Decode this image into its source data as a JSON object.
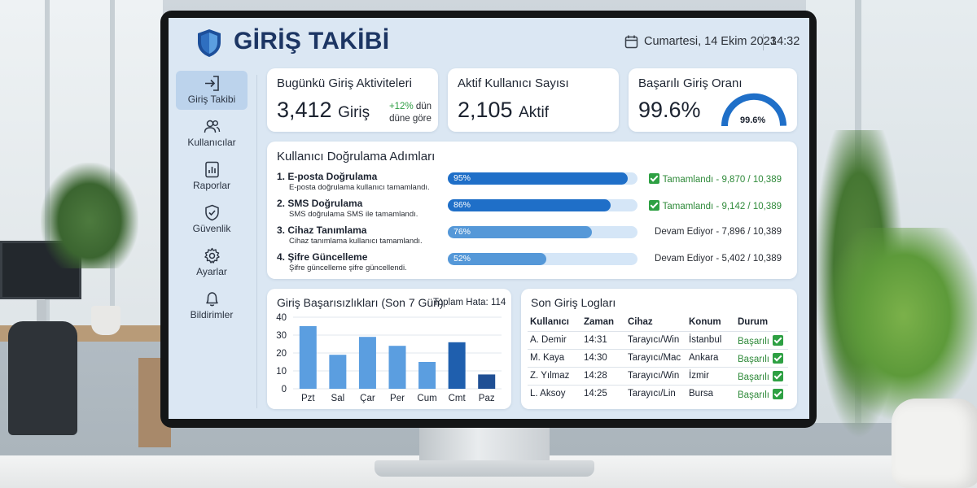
{
  "header": {
    "app_title": "GİRİŞ TAKİBİ",
    "date": "Cumartesi, 14 Ekim 2023",
    "time": "14:32"
  },
  "sidebar": {
    "items": [
      {
        "label": "Giriş Takibi",
        "icon": "login-icon",
        "active": true
      },
      {
        "label": "Kullanıcılar",
        "icon": "users-icon",
        "active": false
      },
      {
        "label": "Raporlar",
        "icon": "report-icon",
        "active": false
      },
      {
        "label": "Güvenlik",
        "icon": "shield-check-icon",
        "active": false
      },
      {
        "label": "Ayarlar",
        "icon": "gear-icon",
        "active": false
      },
      {
        "label": "Bildirimler",
        "icon": "bell-icon",
        "active": false
      }
    ]
  },
  "stats": {
    "daily": {
      "title": "Bugünkü Giriş Aktiviteleri",
      "value": "3,412",
      "unit": "Giriş",
      "trend_pct": "+12%",
      "trend_suffix": "dün",
      "trend_line2": "düne göre"
    },
    "active": {
      "title": "Aktif Kullanıcı Sayısı",
      "value": "2,105",
      "unit": "Aktif"
    },
    "success": {
      "title": "Başarılı Giriş Oranı",
      "value": "99.6%",
      "gauge_label": "99.6%",
      "gauge_fraction": 0.996
    }
  },
  "verification": {
    "title": "Kullanıcı Doğrulama Adımları",
    "steps": [
      {
        "num": "1.",
        "title": "E-posta Doğrulama",
        "desc": "E-posta doğrulama kullanıcı tamamlandı.",
        "pct_label": "95%",
        "fraction": 0.95,
        "status": "Tamamlandı",
        "count": "9,870 / 10,389",
        "done": true
      },
      {
        "num": "2.",
        "title": "SMS Doğrulama",
        "desc": "SMS doğrulama SMS ile tamamlandı.",
        "pct_label": "86%",
        "fraction": 0.86,
        "status": "Tamamlandı",
        "count": "9,142 / 10,389",
        "done": true
      },
      {
        "num": "3.",
        "title": "Cihaz Tanımlama",
        "desc": "Cihaz tanımlama kullanıcı tamamlandı.",
        "pct_label": "76%",
        "fraction": 0.76,
        "status": "Devam Ediyor",
        "count": "7,896 / 10,389",
        "done": false
      },
      {
        "num": "4.",
        "title": "Şifre Güncelleme",
        "desc": "Şifre güncelleme şifre güncellendi.",
        "pct_label": "52%",
        "fraction": 0.52,
        "status": "Devam Ediyor",
        "count": "5,402 / 10,389",
        "done": false
      }
    ],
    "colors": {
      "done": "#1f6fc8",
      "progress": "#5598d8",
      "track": "#d5e6f7"
    }
  },
  "failures": {
    "title": "Giriş Başarısızlıkları (Son 7 Gün)",
    "total_label": "Toplam Hata: 114"
  },
  "chart_data": {
    "type": "bar",
    "categories": [
      "Pzt",
      "Sal",
      "Çar",
      "Per",
      "Cum",
      "Cmt",
      "Paz"
    ],
    "values": [
      35,
      19,
      29,
      24,
      15,
      26,
      8
    ],
    "yticks": [
      0,
      10,
      20,
      30,
      40
    ],
    "ylim": [
      0,
      40
    ],
    "title": "Giriş Başarısızlıkları (Son 7 Gün)",
    "grid": true,
    "bar_colors": [
      "#5b9ee0",
      "#5b9ee0",
      "#5b9ee0",
      "#5b9ee0",
      "#5b9ee0",
      "#1f5fae",
      "#1f4f94"
    ]
  },
  "logs": {
    "title": "Son Giriş Logları",
    "columns": [
      "Kullanıcı",
      "Zaman",
      "Cihaz",
      "Konum",
      "Durum"
    ],
    "rows": [
      [
        "A. Demir",
        "14:31",
        "Tarayıcı/Win",
        "İstanbul",
        "Başarılı"
      ],
      [
        "M. Kaya",
        "14:30",
        "Tarayıcı/Mac",
        "Ankara",
        "Başarılı"
      ],
      [
        "Z. Yılmaz",
        "14:28",
        "Tarayıcı/Win",
        "İzmir",
        "Başarılı"
      ],
      [
        "L. Aksoy",
        "14:25",
        "Tarayıcı/Lin",
        "Bursa",
        "Başarılı"
      ]
    ]
  }
}
